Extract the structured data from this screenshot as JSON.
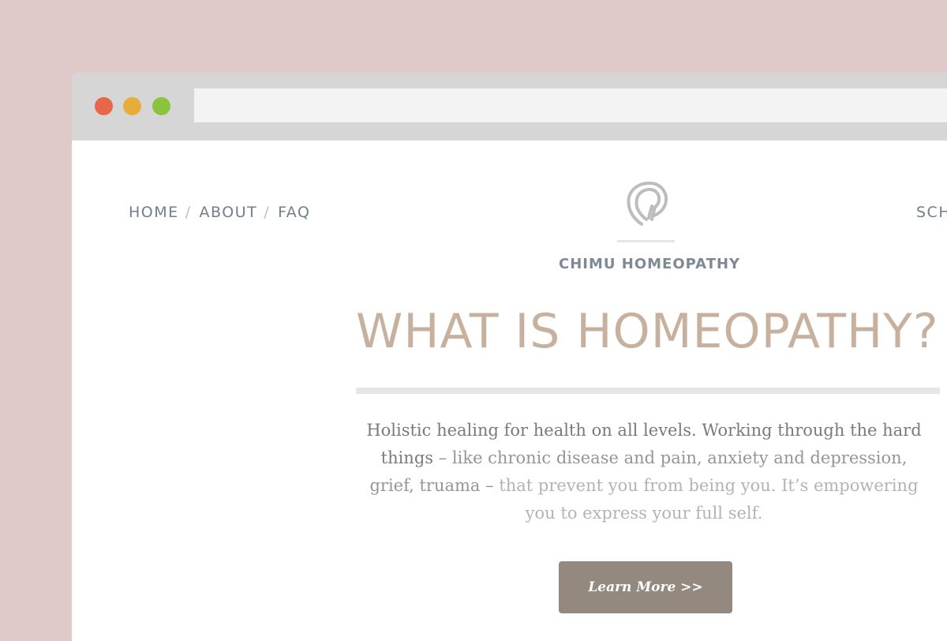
{
  "browser": {
    "controls": [
      "close",
      "minimize",
      "maximize"
    ],
    "address": ""
  },
  "nav": {
    "left": [
      {
        "label": "HOME"
      },
      {
        "label": "ABOUT"
      },
      {
        "label": "FAQ"
      }
    ],
    "separator": "/",
    "right_label": "SCH"
  },
  "brand": {
    "name": "CHIMU HOMEOPATHY",
    "icon": "flame-logo-icon"
  },
  "hero": {
    "title": "WHAT IS HOMEOPATHY?",
    "text_part1": "Holistic healing for health on all levels. Working through the hard things",
    "text_part2": " – like chronic disease and pain, anxiety and depression, grief, truama – ",
    "text_part3": "that prevent you from being you. It’s empowering you to express your full self.",
    "cta_label": "Learn More >>"
  },
  "colors": {
    "background": "#dfc9c9",
    "nav": "#6f7f8c",
    "title": "#c7b19e",
    "button": "#93897f"
  }
}
